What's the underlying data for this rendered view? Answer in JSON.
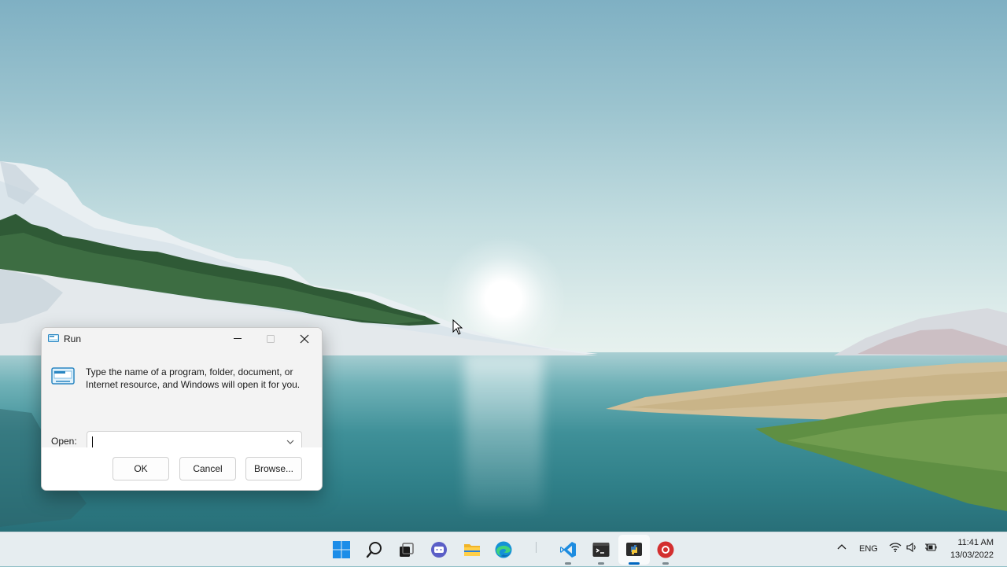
{
  "dialog": {
    "title": "Run",
    "description": "Type the name of a program, folder, document, or Internet resource, and Windows will open it for you.",
    "open_label": "Open:",
    "open_value": "",
    "ok_label": "OK",
    "cancel_label": "Cancel",
    "browse_label": "Browse...",
    "title_icon": "run-icon",
    "accent_color": "#0067c0"
  },
  "taskbar": {
    "apps": [
      {
        "name": "start",
        "icon": "windows-logo-icon"
      },
      {
        "name": "search",
        "icon": "search-icon"
      },
      {
        "name": "task-view",
        "icon": "task-view-icon"
      },
      {
        "name": "chat",
        "icon": "teams-chat-icon"
      },
      {
        "name": "file-explorer",
        "icon": "folder-icon"
      },
      {
        "name": "edge",
        "icon": "edge-icon"
      },
      {
        "name": "vscode",
        "icon": "vscode-icon",
        "running": true
      },
      {
        "name": "terminal",
        "icon": "terminal-icon",
        "running": true
      },
      {
        "name": "python",
        "icon": "python-icon",
        "running": true,
        "active": true
      },
      {
        "name": "recorder",
        "icon": "record-icon",
        "running": true
      }
    ],
    "tray": {
      "language": "ENG",
      "time": "11:41 AM",
      "date": "13/03/2022"
    }
  }
}
